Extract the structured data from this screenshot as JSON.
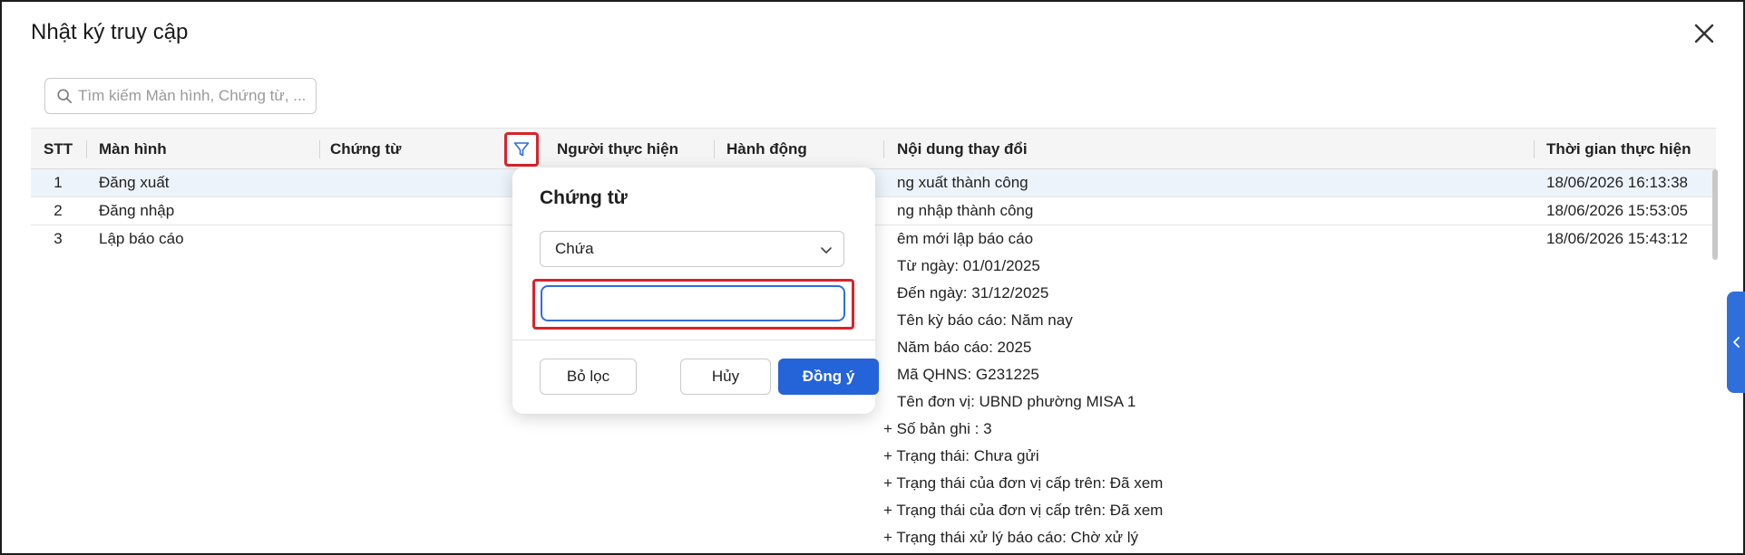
{
  "dialog": {
    "title": "Nhật ký truy cập"
  },
  "search": {
    "placeholder": "Tìm kiếm Màn hình, Chứng từ, ..."
  },
  "table": {
    "columns": [
      "STT",
      "Màn hình",
      "Chứng từ",
      "Người thực hiện",
      "Hành động",
      "Nội dung thay đổi",
      "Thời gian thực hiện"
    ],
    "rows": [
      {
        "stt": "1",
        "screen": "Đăng xuất",
        "content": [
          "ng xuất thành công"
        ],
        "time": "18/06/2026 16:13:38"
      },
      {
        "stt": "2",
        "screen": "Đăng nhập",
        "content": [
          "ng nhập thành công"
        ],
        "time": "18/06/2026 15:53:05"
      },
      {
        "stt": "3",
        "screen": "Lập báo cáo",
        "content": [
          "êm mới lập báo cáo",
          "Từ ngày: 01/01/2025",
          "Đến ngày: 31/12/2025",
          "Tên kỳ báo cáo: Năm nay",
          "Năm báo cáo: 2025",
          "Mã QHNS: G231225",
          "Tên đơn vị: UBND phường MISA 1",
          "+ Số bản ghi : 3",
          "+ Trạng thái: Chưa gửi",
          "+ Trạng thái của đơn vị cấp trên: Đã xem",
          "+ Trạng thái của đơn vị cấp trên: Đã xem",
          "+ Trạng thái xử lý báo cáo: Chờ xử lý"
        ],
        "time": "18/06/2026 15:43:12"
      }
    ]
  },
  "filter_popover": {
    "title": "Chứng từ",
    "operator": "Chứa",
    "value": "",
    "buttons": {
      "clear": "Bỏ lọc",
      "cancel": "Hủy",
      "apply": "Đồng ý"
    }
  },
  "colors": {
    "primary": "#2563d9",
    "highlight": "#d8232a",
    "selected_row": "#edf3fb"
  }
}
